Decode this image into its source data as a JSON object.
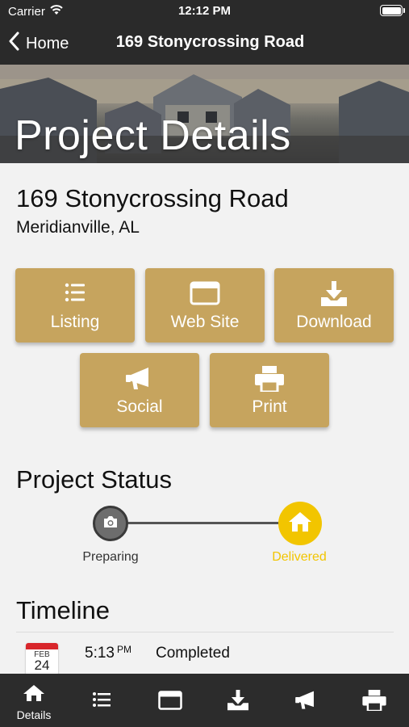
{
  "status_bar": {
    "carrier": "Carrier",
    "time": "12:12 PM"
  },
  "nav": {
    "back_label": "Home",
    "title": "169 Stonycrossing Road"
  },
  "hero": {
    "title": "Project Details"
  },
  "address": {
    "street": "169 Stonycrossing Road",
    "city": "Meridianville, AL"
  },
  "actions": [
    {
      "label": "Listing",
      "icon": "list-icon"
    },
    {
      "label": "Web Site",
      "icon": "browser-window-icon"
    },
    {
      "label": "Download",
      "icon": "download-icon"
    },
    {
      "label": "Social",
      "icon": "megaphone-icon"
    },
    {
      "label": "Print",
      "icon": "printer-icon"
    }
  ],
  "project_status": {
    "title": "Project Status",
    "steps": [
      {
        "label": "Preparing",
        "icon": "camera-icon",
        "color": "#333333"
      },
      {
        "label": "Delivered",
        "icon": "home-icon",
        "color": "#f2c500"
      }
    ]
  },
  "timeline": {
    "title": "Timeline",
    "entries": [
      {
        "month": "FEB",
        "day": "24",
        "time": "5:13",
        "ampm": "PM",
        "status": "Completed"
      }
    ]
  },
  "tabbar": {
    "active_label": "Details",
    "tabs": [
      "home-icon",
      "list-icon",
      "browser-window-icon",
      "download-icon",
      "megaphone-icon",
      "printer-icon"
    ]
  },
  "colors": {
    "accent": "#c6a45e",
    "delivered": "#f2c500",
    "bar_dark": "#2a2a2a"
  }
}
